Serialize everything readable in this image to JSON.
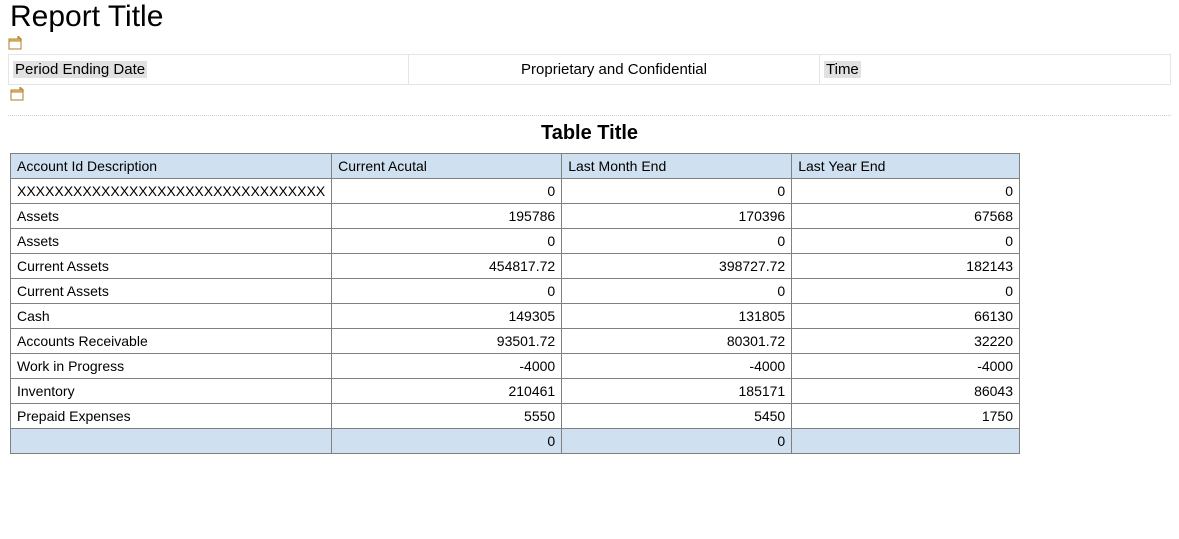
{
  "header": {
    "report_title": "Report Title",
    "period_label": "Period Ending Date",
    "center_text": "Proprietary and Confidential",
    "time_label": "Time"
  },
  "table": {
    "title": "Table Title",
    "columns": [
      "Account Id Description",
      "Current Acutal",
      "Last Month End",
      "Last Year End"
    ],
    "rows": [
      {
        "desc": "XXXXXXXXXXXXXXXXXXXXXXXXXXXXXXXXX",
        "c1": "0",
        "c2": "0",
        "c3": "0"
      },
      {
        "desc": "Assets",
        "c1": "195786",
        "c2": "170396",
        "c3": "67568"
      },
      {
        "desc": "Assets",
        "c1": "0",
        "c2": "0",
        "c3": "0"
      },
      {
        "desc": "Current Assets",
        "c1": "454817.72",
        "c2": "398727.72",
        "c3": "182143"
      },
      {
        "desc": "Current Assets",
        "c1": "0",
        "c2": "0",
        "c3": "0"
      },
      {
        "desc": "Cash",
        "c1": "149305",
        "c2": "131805",
        "c3": "66130"
      },
      {
        "desc": "Accounts Receivable",
        "c1": "93501.72",
        "c2": "80301.72",
        "c3": "32220"
      },
      {
        "desc": "Work in Progress",
        "c1": "-4000",
        "c2": "-4000",
        "c3": "-4000"
      },
      {
        "desc": "Inventory",
        "c1": "210461",
        "c2": "185171",
        "c3": "86043"
      },
      {
        "desc": "Prepaid Expenses",
        "c1": "5550",
        "c2": "5450",
        "c3": "1750"
      }
    ],
    "footer": {
      "desc": "",
      "c1": "0",
      "c2": "0",
      "c3": ""
    }
  }
}
